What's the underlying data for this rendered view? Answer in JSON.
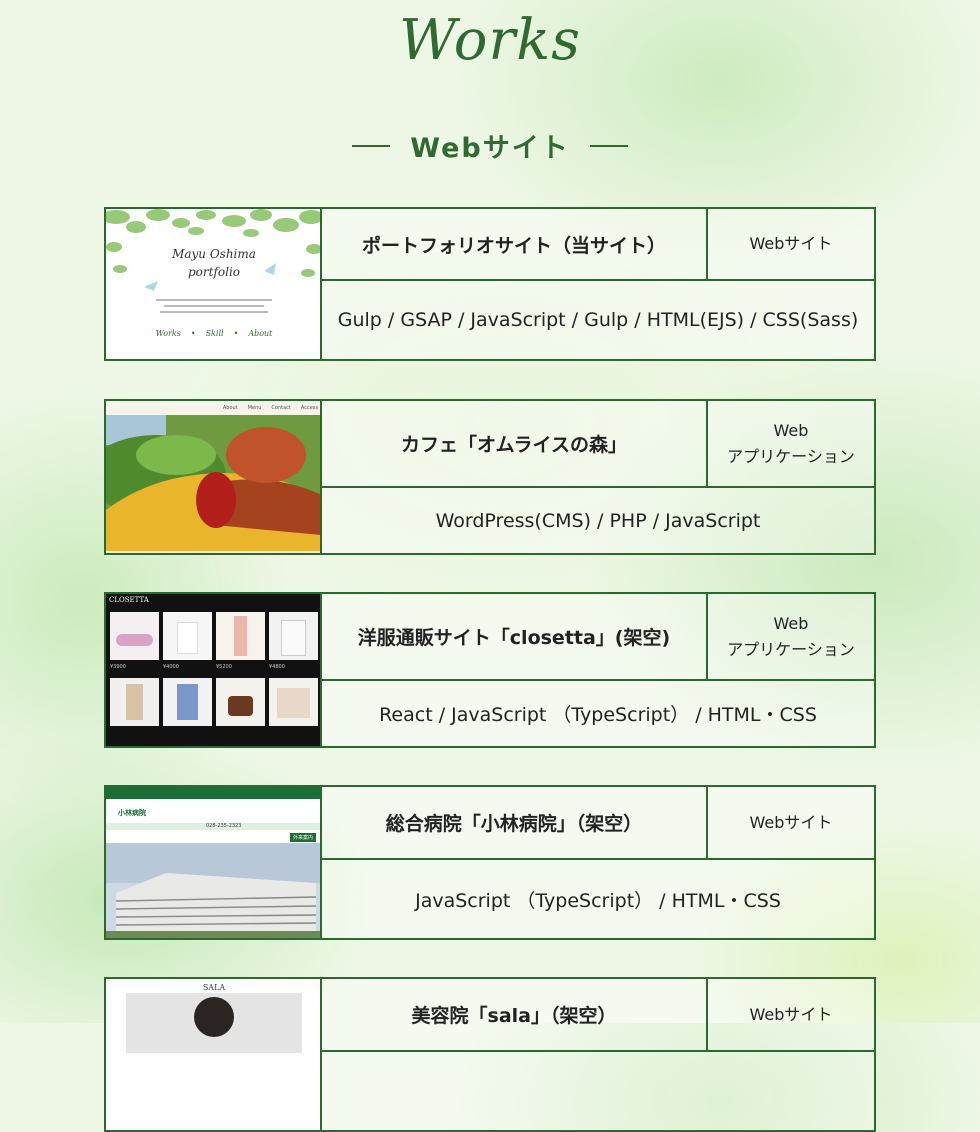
{
  "title": "Works",
  "section_heading": "Webサイト",
  "cards": [
    {
      "name": "ポートフォリオサイト（当サイト）",
      "type": "Webサイト",
      "tech": "Gulp / GSAP / JavaScript / Gulp / HTML(EJS) / CSS(Sass)",
      "thumb": {
        "title_line1": "Mayu Oshima",
        "title_line2": "portfolio",
        "nav": [
          "Works",
          "Skill",
          "About"
        ]
      }
    },
    {
      "name": "カフェ「オムライスの森」",
      "type_line1": "Web",
      "type_line2": "アプリケーション",
      "tech": "WordPress(CMS) / PHP / JavaScript",
      "thumb": {
        "nav": [
          "About",
          "Menu",
          "Contact",
          "Access"
        ]
      }
    },
    {
      "name": "洋服通販サイト「closetta」(架空)",
      "type_line1": "Web",
      "type_line2": "アプリケーション",
      "tech": "React / JavaScript （TypeScript） / HTML・CSS",
      "thumb": {
        "brand": "CLOSETTA",
        "prices": [
          "¥3900",
          "¥4000",
          "¥5200",
          "¥4800"
        ]
      }
    },
    {
      "name": "総合病院「小林病院」（架空）",
      "type": "Webサイト",
      "tech": "JavaScript （TypeScript） / HTML・CSS",
      "thumb": {
        "brand": "小林病院",
        "phone": "028-235-2323",
        "button": "外来案内"
      }
    },
    {
      "name": "美容院「sala」（架空）",
      "type": "Webサイト",
      "thumb": {
        "brand": "SALA"
      }
    }
  ],
  "colors": {
    "accent": "#2f6a30",
    "border": "#2b6a2f"
  }
}
